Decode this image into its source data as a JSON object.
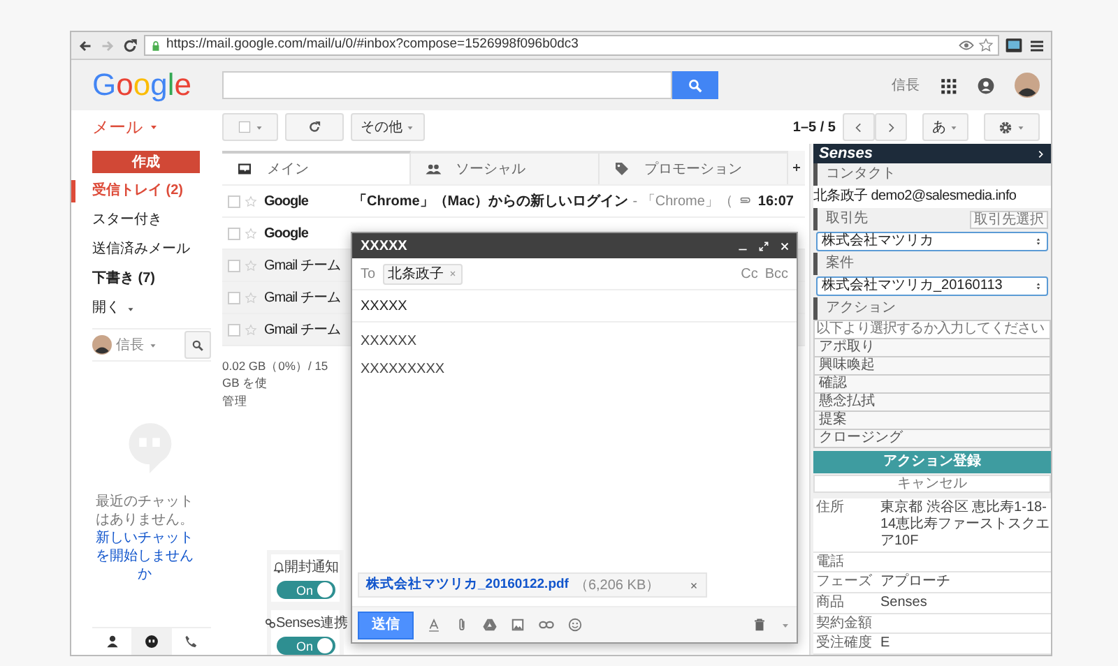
{
  "browser": {
    "url": "https://mail.google.com/mail/u/0/#inbox?compose=1526998f096b0dc3",
    "forward_disabled": true
  },
  "header": {
    "logo": "Google",
    "user": "信長"
  },
  "toolbar": {
    "app_menu": "メール",
    "more": "その他",
    "page_range": "1–5 / 5",
    "input_method": "あ"
  },
  "sidebar": {
    "compose": "作成",
    "items": [
      {
        "label": "受信トレイ (2)",
        "selected": true,
        "bold": true
      },
      {
        "label": "スター付き",
        "selected": false,
        "bold": false
      },
      {
        "label": "送信済みメール",
        "selected": false,
        "bold": false
      },
      {
        "label": "下書き (7)",
        "selected": false,
        "bold": true
      },
      {
        "label": "開く",
        "selected": false,
        "bold": false
      }
    ],
    "hangouts_user": "信長",
    "chat_empty": "最近のチャットはありません。",
    "chat_link": "新しいチャットを開始しませんか",
    "bottom_tabs": [
      {
        "kind": "contacts",
        "selected": false
      },
      {
        "kind": "hangouts",
        "selected": true
      },
      {
        "kind": "phone",
        "selected": false
      }
    ]
  },
  "inbox": {
    "tabs": [
      {
        "kind": "primary",
        "label": "メイン",
        "selected": true
      },
      {
        "kind": "social",
        "label": "ソーシャル",
        "selected": false
      },
      {
        "kind": "promotions",
        "label": "プロモーション",
        "selected": false
      }
    ],
    "rows": [
      {
        "sender": "Google",
        "unread": true,
        "subject": "「Chrome」（Mac）からの新しいログイン",
        "snippet": "- 「Chrome」（",
        "attachment": true,
        "time": "16:07"
      },
      {
        "sender": "Google",
        "unread": true
      },
      {
        "sender": "Gmail チーム",
        "unread": false
      },
      {
        "sender": "Gmail チーム",
        "unread": false
      },
      {
        "sender": "Gmail チーム",
        "unread": false
      }
    ],
    "storage": "0.02 GB（0%）/ 15 GB を使",
    "manage": "管理"
  },
  "compose": {
    "title": "XXXXX",
    "to_label": "To",
    "recipients": [
      "北条政子"
    ],
    "cc": "Cc",
    "bcc": "Bcc",
    "subject": "XXXXX",
    "body": [
      "XXXXXX",
      "XXXXXXXXX"
    ],
    "attachment": {
      "name": "株式会社マツリカ_20160122.pdf",
      "size": "（6,206 KB）"
    },
    "send": "送信"
  },
  "toggles": [
    {
      "kind": "read-receipt",
      "label": "開封通知",
      "on": true,
      "state_text": "On"
    },
    {
      "kind": "link",
      "label": "Senses連携",
      "on": true,
      "state_text": "On"
    }
  ],
  "senses": {
    "title": "Senses",
    "contact_heading": "コンタクト",
    "contact": "北条政子 demo2@salesmedia.info",
    "account_heading": "取引先",
    "account_button": "取引先選択",
    "account_value": "株式会社マツリカ",
    "deal_heading": "案件",
    "deal_value": "株式会社マツリカ_20160113",
    "action_heading": "アクション",
    "action_placeholder": "以下より選択するか入力してください",
    "actions": [
      "アポ取り",
      "興味喚起",
      "確認",
      "懸念払拭",
      "提案",
      "クロージング"
    ],
    "register": "アクション登録",
    "cancel": "キャンセル",
    "details": [
      {
        "label": "住所",
        "value": "東京都 渋谷区 恵比寿1-18-14恵比寿ファーストスクエア10F"
      },
      {
        "label": "電話"
      },
      {
        "label": "フェーズ",
        "value": "アプローチ"
      },
      {
        "label": "商品",
        "value": "Senses"
      },
      {
        "label": "契約金額"
      },
      {
        "label": "受注確度",
        "value": "E"
      }
    ]
  }
}
